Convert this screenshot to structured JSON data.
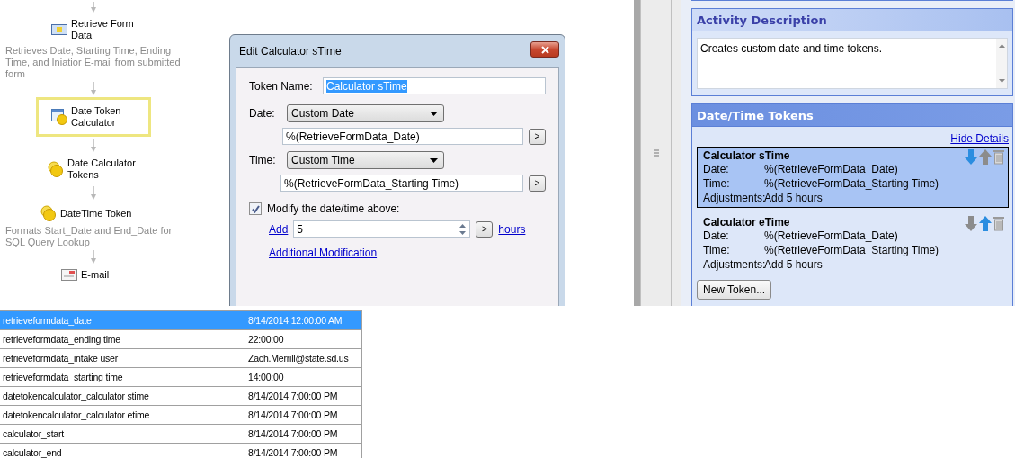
{
  "workflow": {
    "nodes": [
      {
        "kind": "form",
        "title": "Retrieve Form Data",
        "description": "Retrieves Date, Starting Time, Ending Time, and Iniatior E-mail from submitted form",
        "selected": false
      },
      {
        "kind": "calculator",
        "title": "Date Token Calculator",
        "selected": true
      },
      {
        "kind": "coins",
        "title": "Date Calculator Tokens",
        "selected": false
      },
      {
        "kind": "coins",
        "title": "DateTime Token",
        "description": "Formats Start_Date and End_Date for SQL Query Lookup",
        "selected": false
      },
      {
        "kind": "email",
        "title": "E-mail",
        "selected": false
      }
    ]
  },
  "dialog": {
    "title": "Edit Calculator sTime",
    "token_name_label": "Token Name:",
    "token_name": "Calculator sTime",
    "date_label": "Date:",
    "date_mode": "Custom Date",
    "date_value": "%(RetrieveFormData_Date)",
    "date_button": ">",
    "time_label": "Time:",
    "time_mode": "Custom Time",
    "time_value": "%(RetrieveFormData_Starting Time)",
    "time_button": ">",
    "modify": {
      "label": "Modify the date/time above:",
      "checked": true
    },
    "operation": "Add",
    "amount": "5",
    "amount_button": ">",
    "unit": "hours",
    "additional_link": "Additional Modification"
  },
  "activity_description": {
    "title": "Activity Description",
    "text": "Creates custom date and time tokens."
  },
  "tokens": {
    "title": "Date/Time Tokens",
    "hide_details": "Hide Details",
    "new_token": "New Token...",
    "items": [
      {
        "name": "Calculator sTime",
        "selected": true,
        "move_down_enabled": true,
        "move_up_enabled": false,
        "rows": [
          {
            "label": "Date:",
            "value": "%(RetrieveFormData_Date)"
          },
          {
            "label": "Time:",
            "value": "%(RetrieveFormData_Starting Time)"
          },
          {
            "label": "Adjustments:",
            "value": "Add 5 hours"
          }
        ]
      },
      {
        "name": "Calculator eTime",
        "selected": false,
        "move_down_enabled": false,
        "move_up_enabled": true,
        "rows": [
          {
            "label": "Date:",
            "value": "%(RetrieveFormData_Date)"
          },
          {
            "label": "Time:",
            "value": "%(RetrieveFormData_Starting Time)"
          },
          {
            "label": "Adjustments:",
            "value": "Add 5 hours"
          }
        ]
      }
    ]
  },
  "table": {
    "rows": [
      {
        "name": "retrieveformdata_date",
        "value": "8/14/2014 12:00:00 AM",
        "selected": true
      },
      {
        "name": "retrieveformdata_ending time",
        "value": "22:00:00",
        "selected": false
      },
      {
        "name": "retrieveformdata_intake user",
        "value": "Zach.Merrill@state.sd.us",
        "selected": false
      },
      {
        "name": "retrieveformdata_starting time",
        "value": "14:00:00",
        "selected": false
      },
      {
        "name": "datetokencalculator_calculator stime",
        "value": "8/14/2014 7:00:00 PM",
        "selected": false
      },
      {
        "name": "datetokencalculator_calculator etime",
        "value": "8/14/2014 7:00:00 PM",
        "selected": false
      },
      {
        "name": "calculator_start",
        "value": "8/14/2014 7:00:00 PM",
        "selected": false
      },
      {
        "name": "calculator_end",
        "value": "8/14/2014 7:00:00 PM",
        "selected": false
      }
    ]
  }
}
